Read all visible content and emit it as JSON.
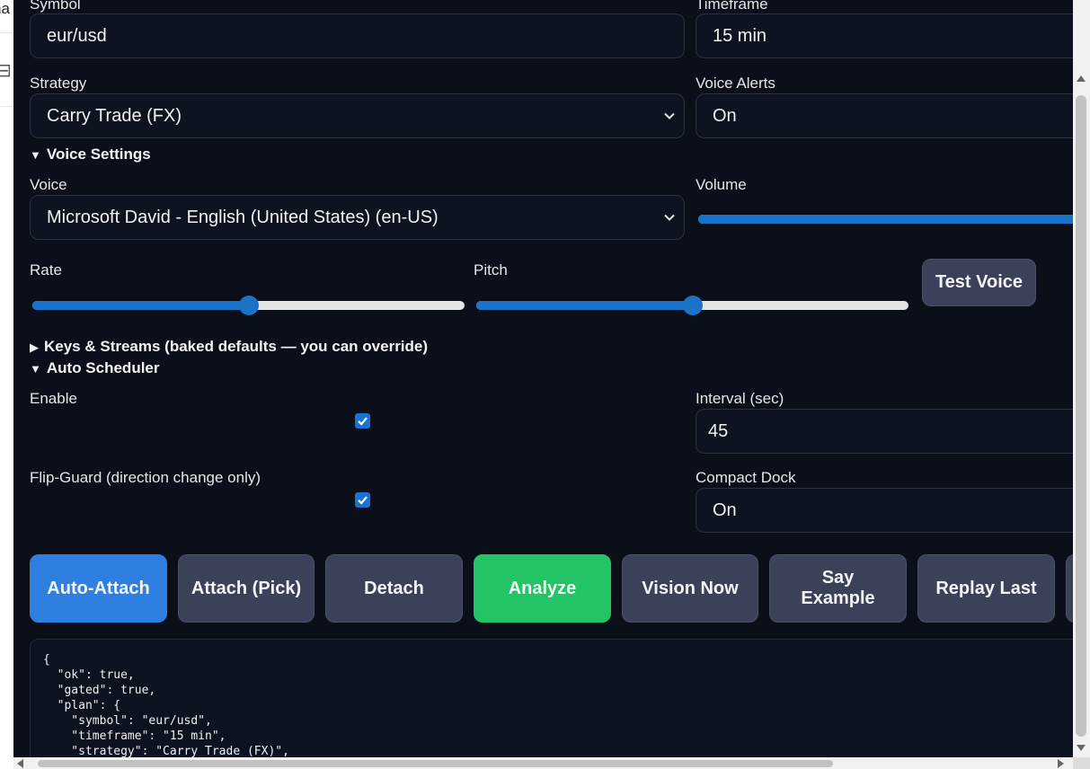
{
  "host": {
    "fragment": "na"
  },
  "form": {
    "symbol": {
      "label": "Symbol",
      "value": "eur/usd"
    },
    "timeframe": {
      "label": "Timeframe",
      "value": "15 min"
    },
    "strategy": {
      "label": "Strategy",
      "value": "Carry Trade (FX)"
    },
    "voice_alerts": {
      "label": "Voice Alerts",
      "value": "On"
    }
  },
  "voice_settings": {
    "title": "Voice Settings",
    "voice": {
      "label": "Voice",
      "value": "Microsoft David - English (United States) (en-US)"
    },
    "volume": {
      "label": "Volume",
      "level": 1.0
    },
    "rate": {
      "label": "Rate",
      "level": 0.5
    },
    "pitch": {
      "label": "Pitch",
      "level": 0.5
    },
    "test_button": "Test Voice"
  },
  "keys_streams": {
    "title": "Keys & Streams (baked defaults — you can override)",
    "expanded": false
  },
  "auto_scheduler": {
    "title": "Auto Scheduler",
    "enable": {
      "label": "Enable",
      "checked": true
    },
    "interval": {
      "label": "Interval (sec)",
      "value": "45"
    },
    "flip_guard": {
      "label": "Flip-Guard (direction change only)",
      "checked": true
    },
    "compact_dock": {
      "label": "Compact Dock",
      "value": "On"
    }
  },
  "actions": {
    "auto_attach": "Auto-Attach",
    "attach_pick": "Attach (Pick)",
    "detach": "Detach",
    "analyze": "Analyze",
    "vision_now": "Vision Now",
    "say_example": "Say Example",
    "replay_last": "Replay Last"
  },
  "output": {
    "text": "{\n  \"ok\": true,\n  \"gated\": true,\n  \"plan\": {\n    \"symbol\": \"eur/usd\",\n    \"timeframe\": \"15 min\",\n    \"strategy\": \"Carry Trade (FX)\","
  },
  "colors": {
    "panel_bg": "#0b0f1a",
    "primary": "#2f7fe0",
    "success": "#22c466",
    "button": "#3a4158",
    "slider": "#1873c9"
  }
}
